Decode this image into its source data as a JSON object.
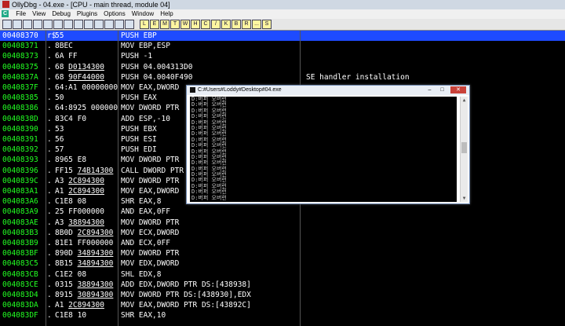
{
  "window": {
    "title": "OllyDbg - 04.exe - [CPU - main thread, module 04]"
  },
  "menu": [
    "File",
    "View",
    "Debug",
    "Plugins",
    "Options",
    "Window",
    "Help"
  ],
  "toolbar": {
    "buttons": [
      "open",
      "restart",
      "close",
      "run",
      "pause",
      "step-into",
      "step-over",
      "trace-into",
      "trace-over",
      "execute-till-return",
      "goto",
      "step-line",
      "back"
    ],
    "letters": [
      "L",
      "E",
      "M",
      "T",
      "W",
      "H",
      "C",
      "/",
      "K",
      "B",
      "R",
      "...",
      "S"
    ]
  },
  "cpu": {
    "rows": [
      {
        "addr": "00408370",
        "mark": "r$",
        "hex": "55",
        "hex_ul": "",
        "hex_tail": "",
        "dis": "PUSH EBP",
        "comment": "",
        "selected": true
      },
      {
        "addr": "00408371",
        "mark": ".",
        "hex": "8BEC",
        "hex_ul": "",
        "hex_tail": "",
        "dis": "MOV EBP,ESP",
        "comment": ""
      },
      {
        "addr": "00408373",
        "mark": ".",
        "hex": "6A FF",
        "hex_ul": "",
        "hex_tail": "",
        "dis": "PUSH -1",
        "comment": ""
      },
      {
        "addr": "00408375",
        "mark": ".",
        "hex": "68 ",
        "hex_ul": "D0134300",
        "hex_tail": "",
        "dis": "PUSH 04.004313D0",
        "comment": ""
      },
      {
        "addr": "0040837A",
        "mark": ".",
        "hex": "68 ",
        "hex_ul": "90F44000",
        "hex_tail": "",
        "dis": "PUSH 04.0040F490",
        "comment": "SE handler installation"
      },
      {
        "addr": "0040837F",
        "mark": ".",
        "hex": "64:A1 00000000",
        "hex_ul": "",
        "hex_tail": "",
        "dis": "MOV EAX,DWORD",
        "comment": ""
      },
      {
        "addr": "00408385",
        "mark": ".",
        "hex": "50",
        "hex_ul": "",
        "hex_tail": "",
        "dis": "PUSH EAX",
        "comment": ""
      },
      {
        "addr": "00408386",
        "mark": ".",
        "hex": "64:8925 000000",
        "hex_ul": "",
        "hex_tail": "",
        "dis": "MOV DWORD PTR",
        "comment": ""
      },
      {
        "addr": "0040838D",
        "mark": ".",
        "hex": "83C4 F0",
        "hex_ul": "",
        "hex_tail": "",
        "dis": "ADD ESP,-10",
        "comment": ""
      },
      {
        "addr": "00408390",
        "mark": ".",
        "hex": "53",
        "hex_ul": "",
        "hex_tail": "",
        "dis": "PUSH EBX",
        "comment": ""
      },
      {
        "addr": "00408391",
        "mark": ".",
        "hex": "56",
        "hex_ul": "",
        "hex_tail": "",
        "dis": "PUSH ESI",
        "comment": ""
      },
      {
        "addr": "00408392",
        "mark": ".",
        "hex": "57",
        "hex_ul": "",
        "hex_tail": "",
        "dis": "PUSH EDI",
        "comment": ""
      },
      {
        "addr": "00408393",
        "mark": ".",
        "hex": "8965 E8",
        "hex_ul": "",
        "hex_tail": "",
        "dis": "MOV DWORD PTR",
        "comment": ""
      },
      {
        "addr": "00408396",
        "mark": ".",
        "hex": "FF15 ",
        "hex_ul": "74B14300",
        "hex_tail": "",
        "dis": "CALL DWORD PTR",
        "comment": ""
      },
      {
        "addr": "0040839C",
        "mark": ".",
        "hex": "A3 ",
        "hex_ul": "2C894300",
        "hex_tail": "",
        "dis": "MOV DWORD PTR",
        "comment": ""
      },
      {
        "addr": "004083A1",
        "mark": ".",
        "hex": "A1 ",
        "hex_ul": "2C894300",
        "hex_tail": "",
        "dis": "MOV EAX,DWORD",
        "comment": ""
      },
      {
        "addr": "004083A6",
        "mark": ".",
        "hex": "C1E8 08",
        "hex_ul": "",
        "hex_tail": "",
        "dis": "SHR EAX,8",
        "comment": ""
      },
      {
        "addr": "004083A9",
        "mark": ".",
        "hex": "25 FF000000",
        "hex_ul": "",
        "hex_tail": "",
        "dis": "AND EAX,0FF",
        "comment": ""
      },
      {
        "addr": "004083AE",
        "mark": ".",
        "hex": "A3 ",
        "hex_ul": "38894300",
        "hex_tail": "",
        "dis": "MOV DWORD PTR",
        "comment": ""
      },
      {
        "addr": "004083B3",
        "mark": ".",
        "hex": "8B0D ",
        "hex_ul": "2C894300",
        "hex_tail": "",
        "dis": "MOV ECX,DWORD",
        "comment": ""
      },
      {
        "addr": "004083B9",
        "mark": ".",
        "hex": "81E1 FF000000",
        "hex_ul": "",
        "hex_tail": "",
        "dis": "AND ECX,0FF",
        "comment": ""
      },
      {
        "addr": "004083BF",
        "mark": ".",
        "hex": "890D ",
        "hex_ul": "34894300",
        "hex_tail": "",
        "dis": "MOV DWORD PTR",
        "comment": ""
      },
      {
        "addr": "004083C5",
        "mark": ".",
        "hex": "8B15 ",
        "hex_ul": "34894300",
        "hex_tail": "",
        "dis": "MOV EDX,DWORD",
        "comment": ""
      },
      {
        "addr": "004083CB",
        "mark": ".",
        "hex": "C1E2 08",
        "hex_ul": "",
        "hex_tail": "",
        "dis": "SHL EDX,8",
        "comment": ""
      },
      {
        "addr": "004083CE",
        "mark": ".",
        "hex": "0315 ",
        "hex_ul": "38894300",
        "hex_tail": "",
        "dis": "ADD EDX,DWORD PTR DS:[438938]",
        "comment": ""
      },
      {
        "addr": "004083D4",
        "mark": ".",
        "hex": "8915 ",
        "hex_ul": "30894300",
        "hex_tail": "",
        "dis": "MOV DWORD PTR DS:[438930],EDX",
        "comment": ""
      },
      {
        "addr": "004083DA",
        "mark": ".",
        "hex": "A1 ",
        "hex_ul": "2C894300",
        "hex_tail": "",
        "dis": "MOV EAX,DWORD PTR DS:[43892C]",
        "comment": ""
      },
      {
        "addr": "004083DF",
        "mark": ".",
        "hex": "C1E8 10",
        "hex_ul": "",
        "hex_tail": "",
        "dis": "SHR EAX,10",
        "comment": ""
      }
    ]
  },
  "console": {
    "title": "C:#Users#Loddy#Desktop#04.exe",
    "line_text": "D:버퍼 오버런",
    "line_count": 18
  }
}
